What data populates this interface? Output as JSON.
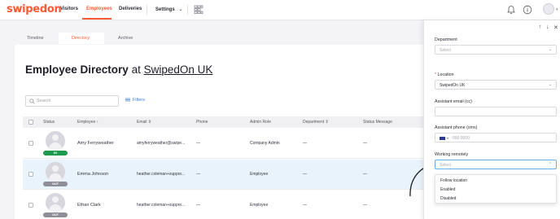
{
  "brand": {
    "logo": "swipedon",
    "accent": "#ff5a36"
  },
  "nav": {
    "items": [
      "Visitors",
      "Employees",
      "Deliveries",
      "Settings"
    ],
    "active": "Employees"
  },
  "subtabs": [
    "Timeline",
    "Directory",
    "Archive"
  ],
  "directory": {
    "title": "Employee Directory",
    "at": "at",
    "location": "SwipedOn UK",
    "search_placeholder": "Search",
    "filters_label": "Filters"
  },
  "table": {
    "columns": [
      "Status",
      "Employee",
      "Email",
      "Phone",
      "Admin Role",
      "Department",
      "Status Message"
    ],
    "rows": [
      {
        "status": "IN",
        "name": "Amy Ferryweather",
        "email": "amyferryweather@swipe...",
        "phone": "—",
        "role": "Company Admin",
        "department": "—",
        "message": "—"
      },
      {
        "status": "OUT",
        "name": "Emma Johnson",
        "email": "heather.coleman+suppor...",
        "phone": "—",
        "role": "Employee",
        "department": "—",
        "message": "—"
      },
      {
        "status": "OUT",
        "name": "Ethan Clark",
        "email": "heather.coleman+suppor...",
        "phone": "—",
        "role": "Employee",
        "department": "—",
        "message": "—"
      }
    ]
  },
  "panel": {
    "department_label": "Department",
    "department_placeholder": "Select",
    "location_label": "Location",
    "location_value": "SwipedOn UK",
    "assistant_email_label": "Assistant email (cc)",
    "assistant_phone_label": "Assistant phone (sms)",
    "phone_placeholder": "000 0000",
    "working_remotely_label": "Working remotely",
    "working_remotely_placeholder": "Select",
    "options": [
      "Follow location",
      "Enabled",
      "Disabled"
    ]
  },
  "icons": [
    "grid-icon",
    "bell-icon",
    "help-icon",
    "user-avatar",
    "search-icon",
    "filter-icon",
    "arrow-up-icon",
    "arrow-down-icon",
    "close-icon",
    "chevron-down-icon"
  ]
}
